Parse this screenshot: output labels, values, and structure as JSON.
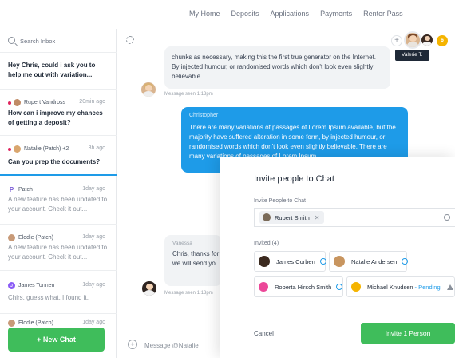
{
  "nav": {
    "links": [
      "My Home",
      "Deposits",
      "Applications",
      "Payments",
      "Renter Pass"
    ]
  },
  "sidebar": {
    "search_placeholder": "Search Inbox",
    "conversations": [
      {
        "sender": "",
        "time": "",
        "preview": "Hey Chris, could i ask you to help me out with variation...",
        "bold": true
      },
      {
        "sender": "Rupert Vandross",
        "time": "20min ago",
        "preview": "How can i improve my chances of getting a deposit?",
        "bold": true
      },
      {
        "sender": "Natalie (Patch) +2",
        "time": "3h ago",
        "preview": "Can you prep the documents?",
        "bold": true
      },
      {
        "sender": "Patch",
        "time": "1day ago",
        "preview": "A new feature has been updated to your account. Check it out...",
        "bold": false
      },
      {
        "sender": "Elodie (Patch)",
        "time": "1day ago",
        "preview": "A new feature has been updated to your account. Check it out...",
        "bold": false
      },
      {
        "sender": "James Tonnen",
        "time": "1day ago",
        "preview": "Chirs, guess what. I found it.",
        "bold": false
      },
      {
        "sender": "Elodie (Patch)",
        "time": "1day ago",
        "preview": "",
        "bold": false
      }
    ],
    "new_chat_label": "+ New Chat"
  },
  "chat": {
    "tooltip": "Valerie T.",
    "avatar_badge": "6",
    "msg1": "chunks as necessary, making this the first true generator on the Internet. By injected humour, or randomised words which don't look even slightly believable.",
    "seen1": "Message seen 1:13pm",
    "msg2_sender": "Christopher",
    "msg2": "There are many variations of passages of Lorem Ipsum available, but the majority have suffered alteration in some form, by injected humour, or randomised words which don't look even slightly believable. There are many variations of passages of Lorem Ipsum",
    "msg3_sender": "Vanessa",
    "msg3": "Chris, thanks for determine if eve we will send yo",
    "seen3": "Message seen 1:13pm",
    "composer_placeholder": "Message @Natalie"
  },
  "modal": {
    "title": "Invite people to Chat",
    "invite_label": "Invite People to Chat",
    "chip": "Rupert Smith",
    "invited_label": "Invited (4)",
    "invitees": [
      {
        "name": "James Corben",
        "status": ""
      },
      {
        "name": "Natalie Andersen",
        "status": ""
      },
      {
        "name": "Roberta Hirsch Smith",
        "status": ""
      },
      {
        "name": "Michael Knudsen",
        "status": "- Pending"
      }
    ],
    "cancel_label": "Cancel",
    "invite_button": "Invite 1 Person"
  }
}
